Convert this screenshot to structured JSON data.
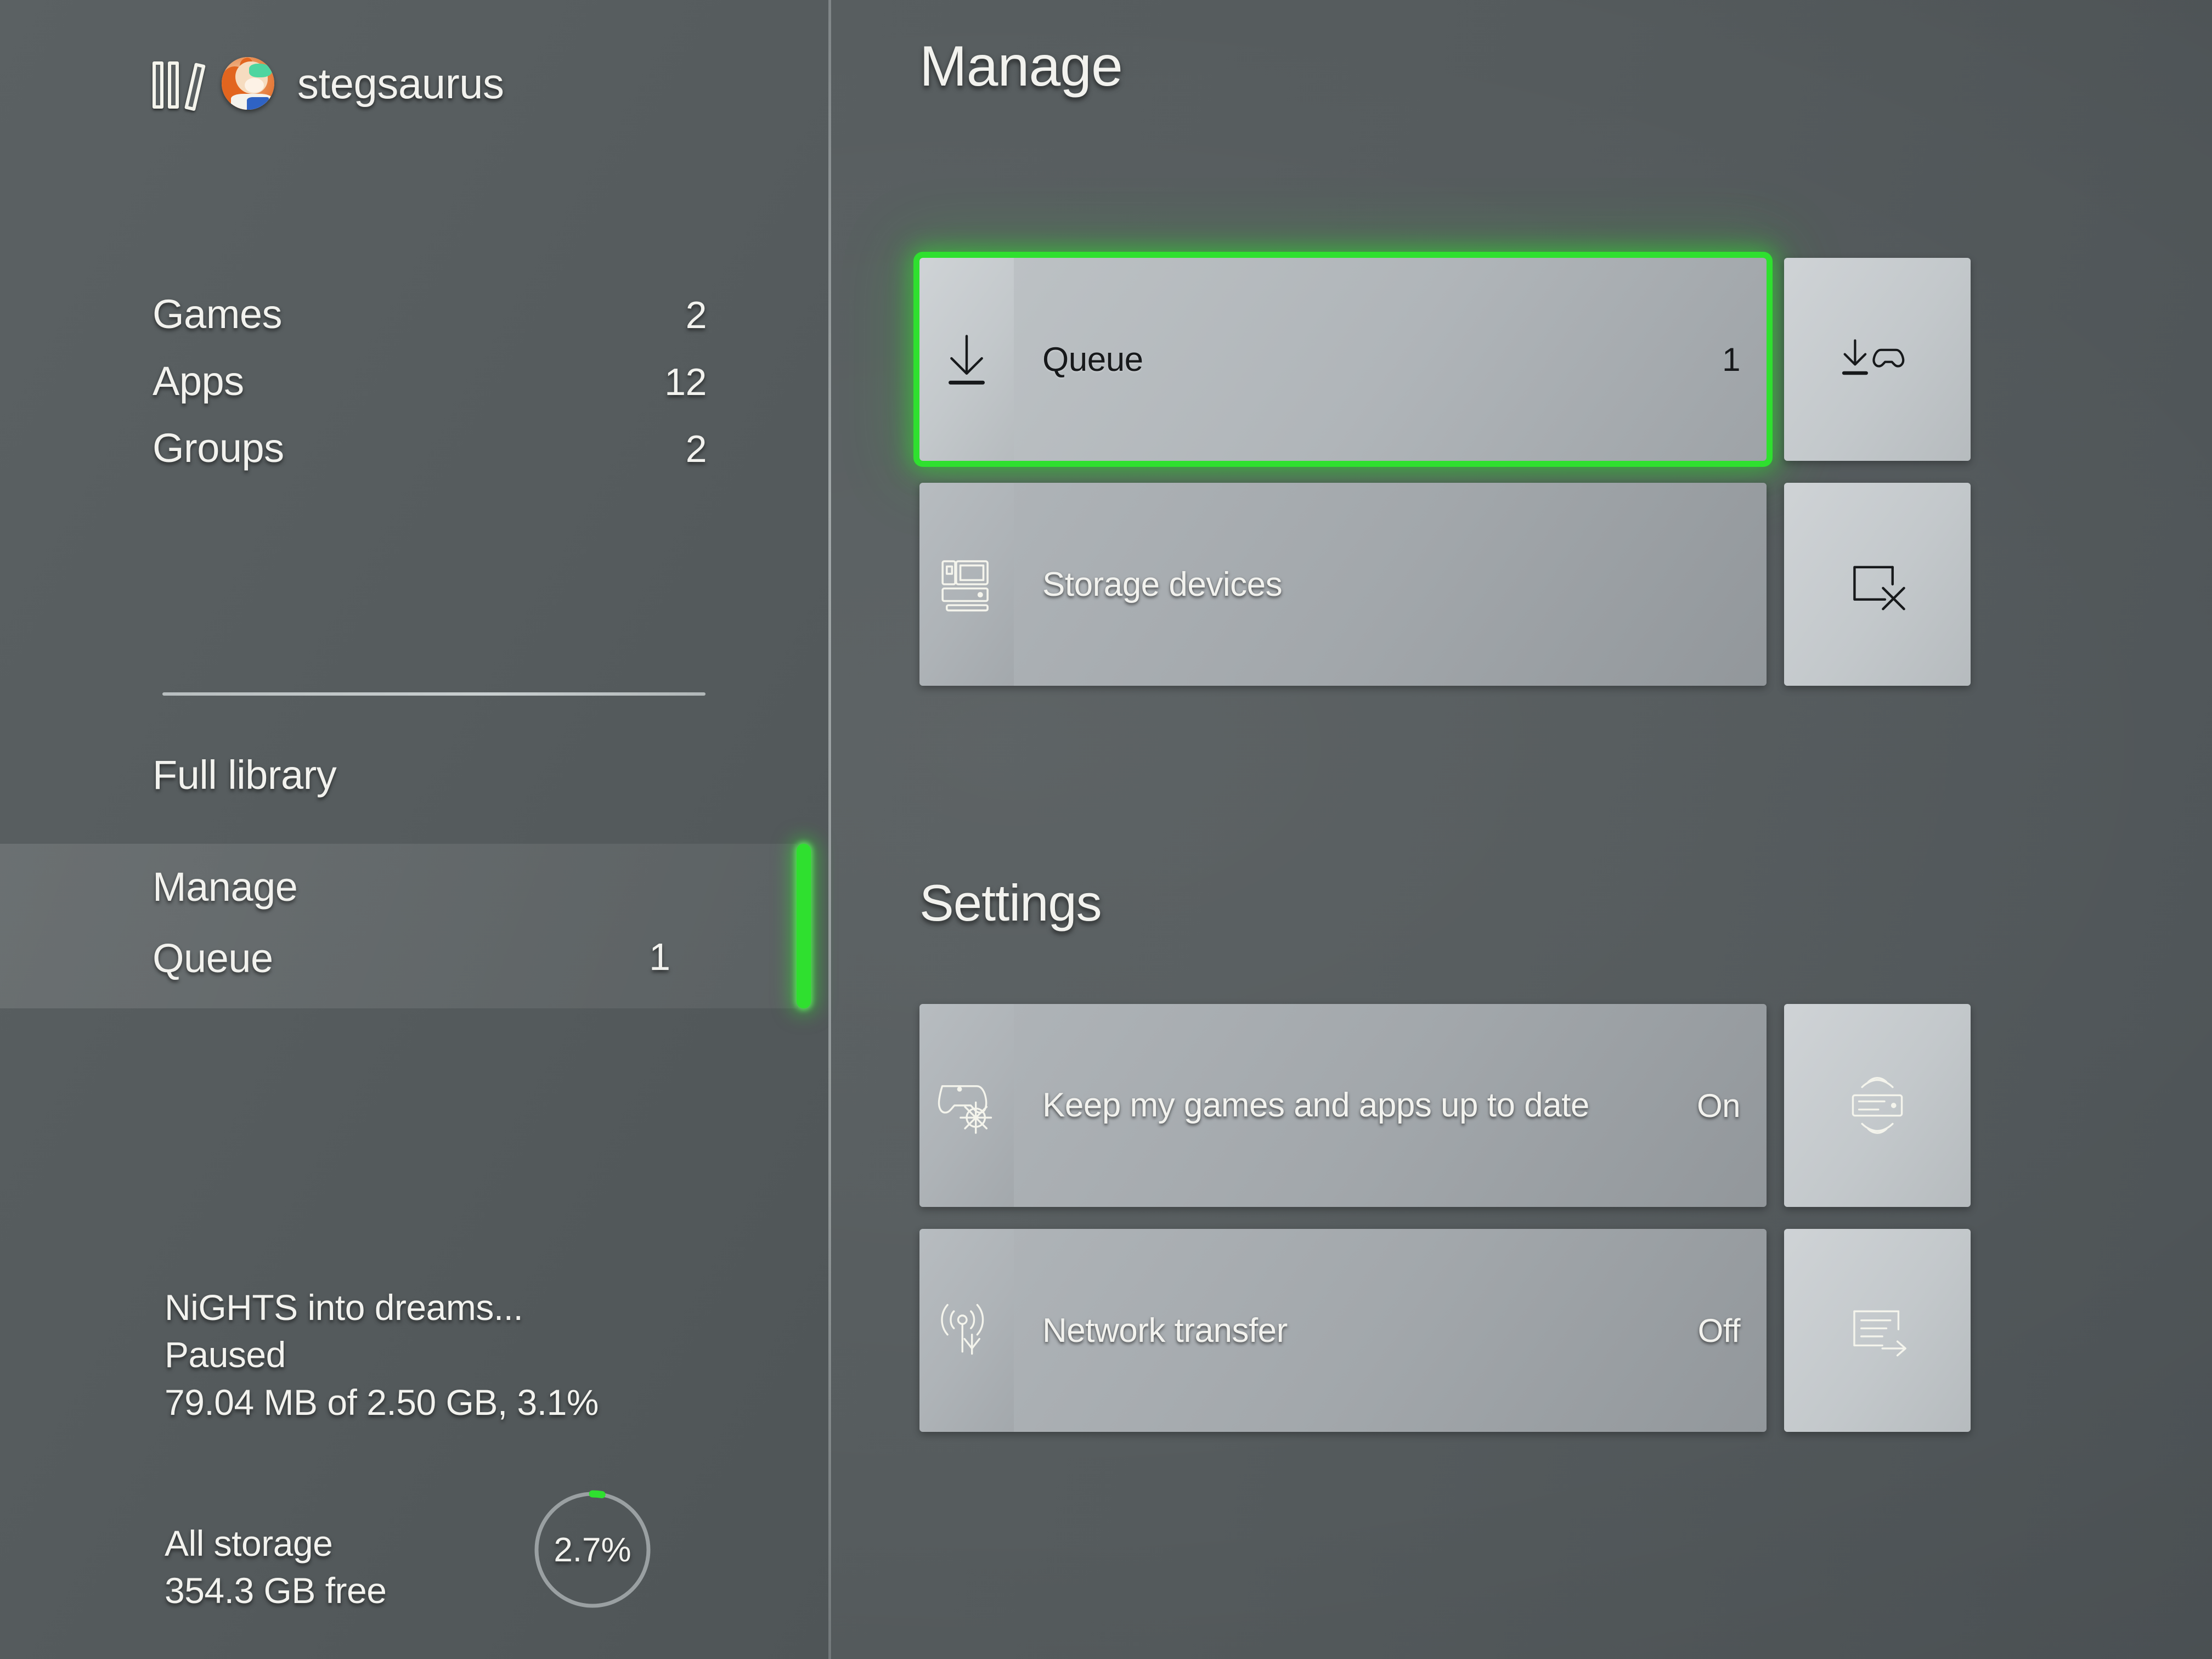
{
  "accent": {
    "focus_green": "#2fe02f",
    "tile_light": "#c6cbce",
    "tile_dim": "#a6abaf",
    "page_bg": "#55595b"
  },
  "sidebar": {
    "library_icon": "books-icon",
    "avatar": "gamer-avatar",
    "gamertag": "stegsaurus",
    "nav": [
      {
        "label": "Games",
        "count": "2"
      },
      {
        "label": "Apps",
        "count": "12"
      },
      {
        "label": "Groups",
        "count": "2"
      }
    ],
    "full_library": "Full library",
    "selected": {
      "manage_label": "Manage",
      "queue_label": "Queue",
      "queue_count": "1"
    },
    "download": {
      "title": "NiGHTS into dreams...",
      "status": "Paused",
      "progress_text": "79.04 MB of 2.50 GB, 3.1%",
      "progress_percent": 3.1
    },
    "storage": {
      "label": "All storage",
      "free": "354.3 GB free",
      "used_percent_text": "2.7%",
      "used_percent": 2.7
    }
  },
  "main": {
    "title": "Manage",
    "manage_tiles": [
      {
        "label": "Queue",
        "value": "1",
        "icon": "download-arrow-icon",
        "focused": true
      },
      {
        "label": "Storage devices",
        "value": "",
        "icon": "storage-device-icon",
        "focused": false
      }
    ],
    "manage_side_tiles": [
      {
        "icon": "install-game-icon"
      },
      {
        "icon": "uninstall-screen-icon"
      }
    ],
    "settings_title": "Settings",
    "settings_tiles": [
      {
        "label": "Keep my games and apps up to date",
        "value": "On",
        "icon": "gamepad-gear-icon"
      },
      {
        "label": "Network transfer",
        "value": "Off",
        "icon": "wireless-download-icon"
      }
    ],
    "settings_side_tiles": [
      {
        "icon": "console-wireless-icon"
      },
      {
        "icon": "list-arrow-icon"
      }
    ]
  }
}
